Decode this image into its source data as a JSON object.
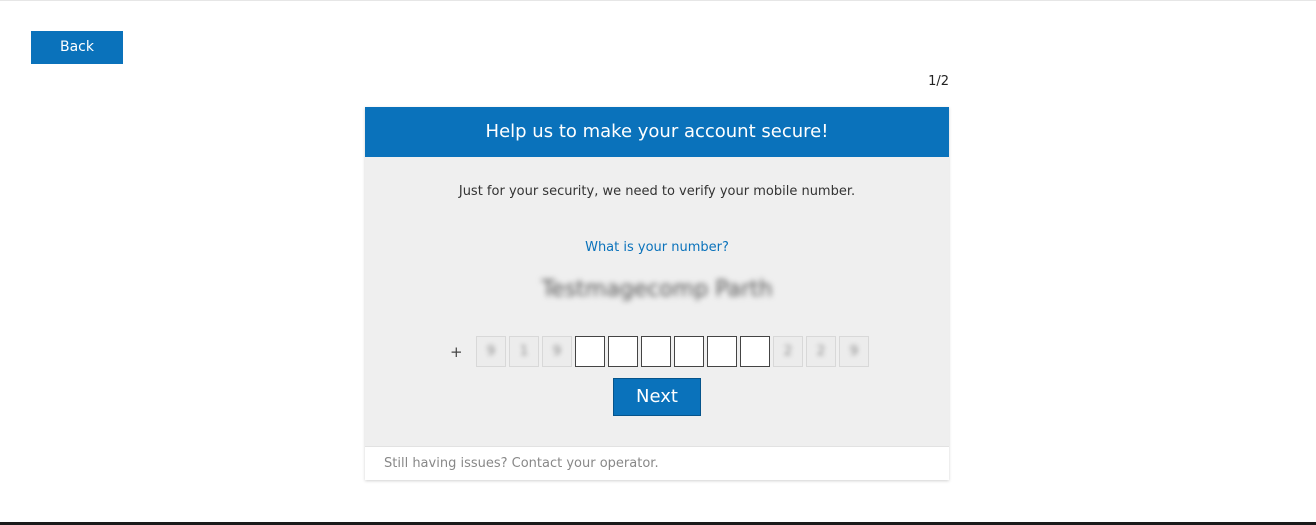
{
  "back_button": {
    "label": "Back"
  },
  "step_indicator": "1/2",
  "card": {
    "title": "Help us to make your account secure!",
    "intro": "Just for your security, we need to verify your mobile number.",
    "question": "What is your number?",
    "name": "Testmagecomp Parth",
    "phone": {
      "plus": "+",
      "prefix_digits": [
        "9",
        "1",
        "9"
      ],
      "editable_count": 6,
      "suffix_digits": [
        "2",
        "2",
        "9"
      ]
    },
    "next_button": {
      "label": "Next"
    },
    "footer": "Still having issues? Contact your operator."
  },
  "colors": {
    "primary": "#0a72bb",
    "card_bg": "#efefef",
    "footer_text": "#888888"
  }
}
